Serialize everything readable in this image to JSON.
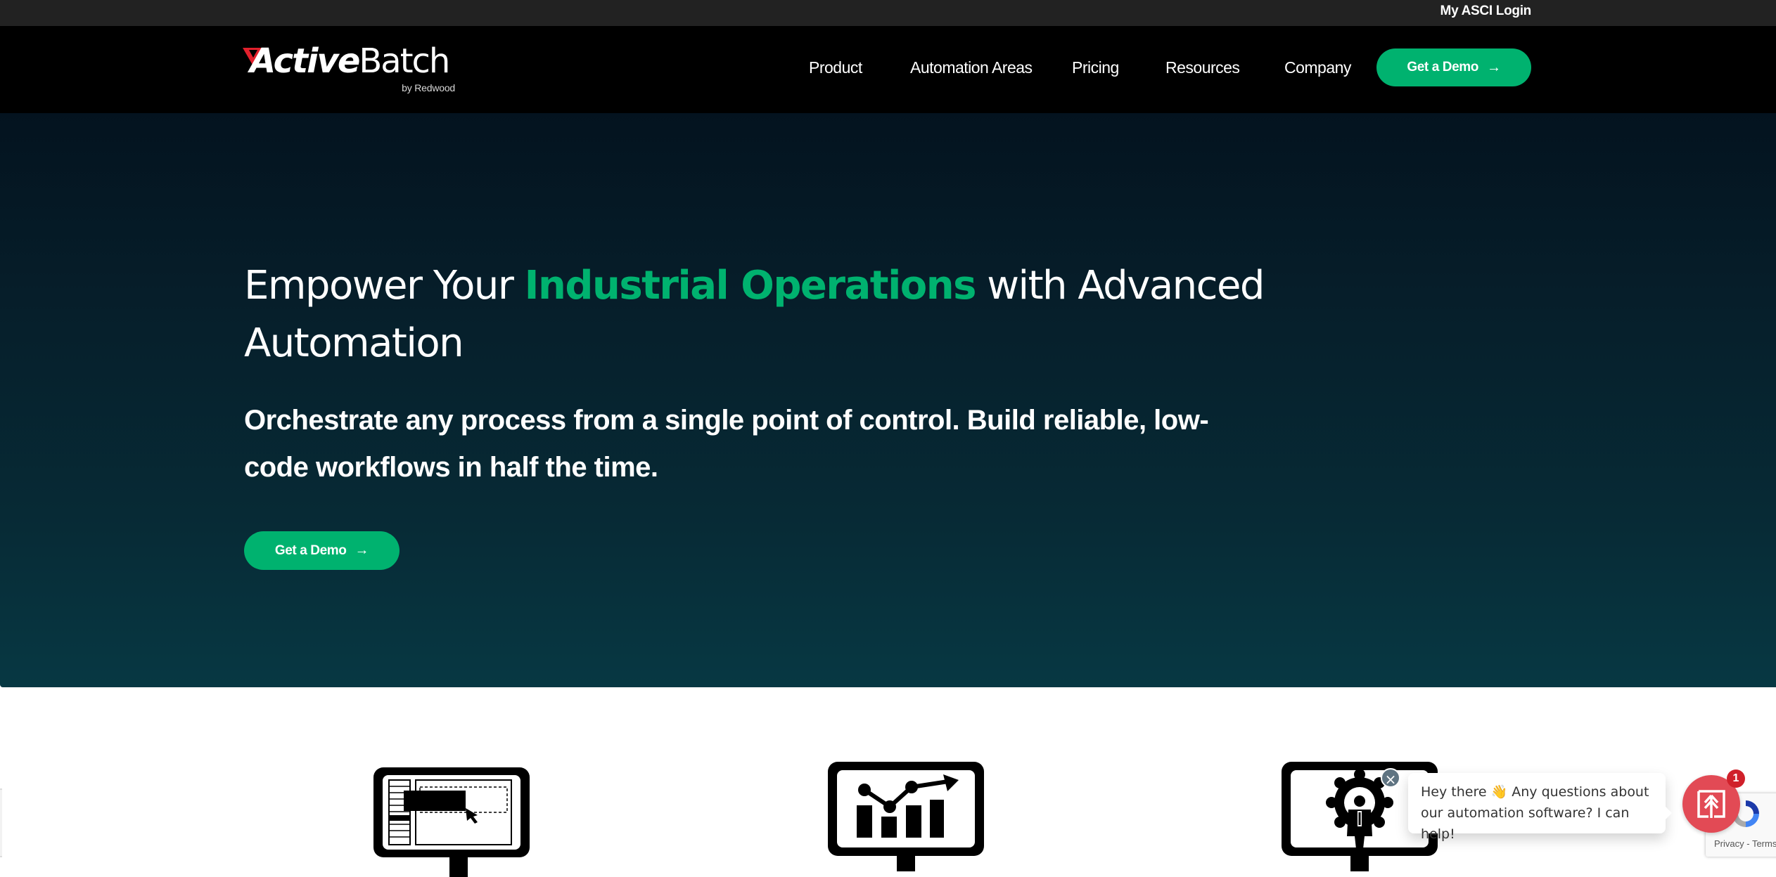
{
  "topbar": {
    "login_link": "My ASCI Login"
  },
  "brand": {
    "name_part1": "Active",
    "name_part2": "Batch",
    "tagline": "by Redwood",
    "accent_color": "#e2202c"
  },
  "nav": {
    "items": [
      {
        "label": "Product"
      },
      {
        "label": "Automation Areas"
      },
      {
        "label": "Pricing"
      },
      {
        "label": "Resources"
      },
      {
        "label": "Company"
      }
    ],
    "cta_label": "Get a Demo",
    "cta_icon": "arrow-right-icon"
  },
  "hero": {
    "title_before": "Empower Your ",
    "title_highlight": "Industrial Operations",
    "title_after": " with Advanced Automation",
    "subtitle": "Orchestrate any process from a single point of control. Build reliable, low-code workflows in half the time.",
    "cta_label": "Get a Demo",
    "highlight_color": "#00b26f",
    "gradient_top": "#04131f",
    "gradient_bottom": "#073843"
  },
  "features": {
    "icons": [
      {
        "name": "monitor-drag-drop-icon"
      },
      {
        "name": "monitor-chart-growth-icon"
      },
      {
        "name": "monitor-gear-person-icon"
      }
    ]
  },
  "chat": {
    "greeting": "Hey there 👋 Any questions about our automation software? I can help!",
    "badge_count": "1",
    "close_symbol": "×"
  },
  "recaptcha": {
    "privacy": "Privacy",
    "separator": " - ",
    "terms": "Terms"
  }
}
